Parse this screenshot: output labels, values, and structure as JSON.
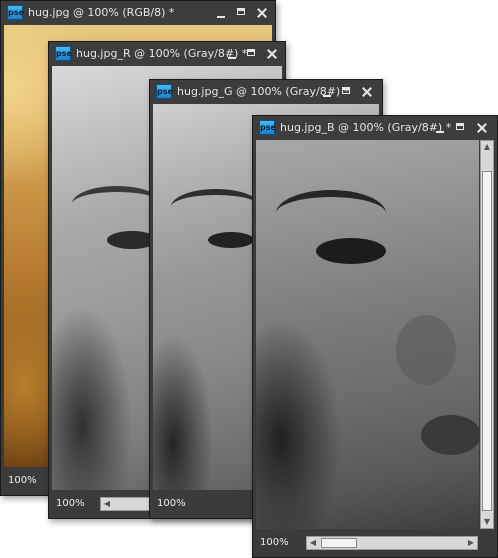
{
  "windows": [
    {
      "id": "rgb",
      "icon_label": "pse",
      "title": "hug.jpg @ 100% (RGB/8) *",
      "zoom": "100%"
    },
    {
      "id": "r",
      "icon_label": "pse",
      "title": "hug.jpg_R @ 100% (Gray/8#) *",
      "zoom": "100%"
    },
    {
      "id": "g",
      "icon_label": "pse",
      "title": "hug.jpg_G @ 100% (Gray/8#) *",
      "zoom": "100%"
    },
    {
      "id": "b",
      "icon_label": "pse",
      "title": "hug.jpg_B @ 100% (Gray/8#) *",
      "zoom": "100%"
    }
  ],
  "colors": {
    "chrome": "#3b3b3b",
    "title_text": "#e6e6e6",
    "scrollbar": "#d8d8d8",
    "icon_blue": "#2f9be0"
  },
  "icons": {
    "app": "pse-app-icon",
    "minimize": "minimize-icon",
    "maximize": "maximize-icon",
    "close": "close-icon"
  }
}
